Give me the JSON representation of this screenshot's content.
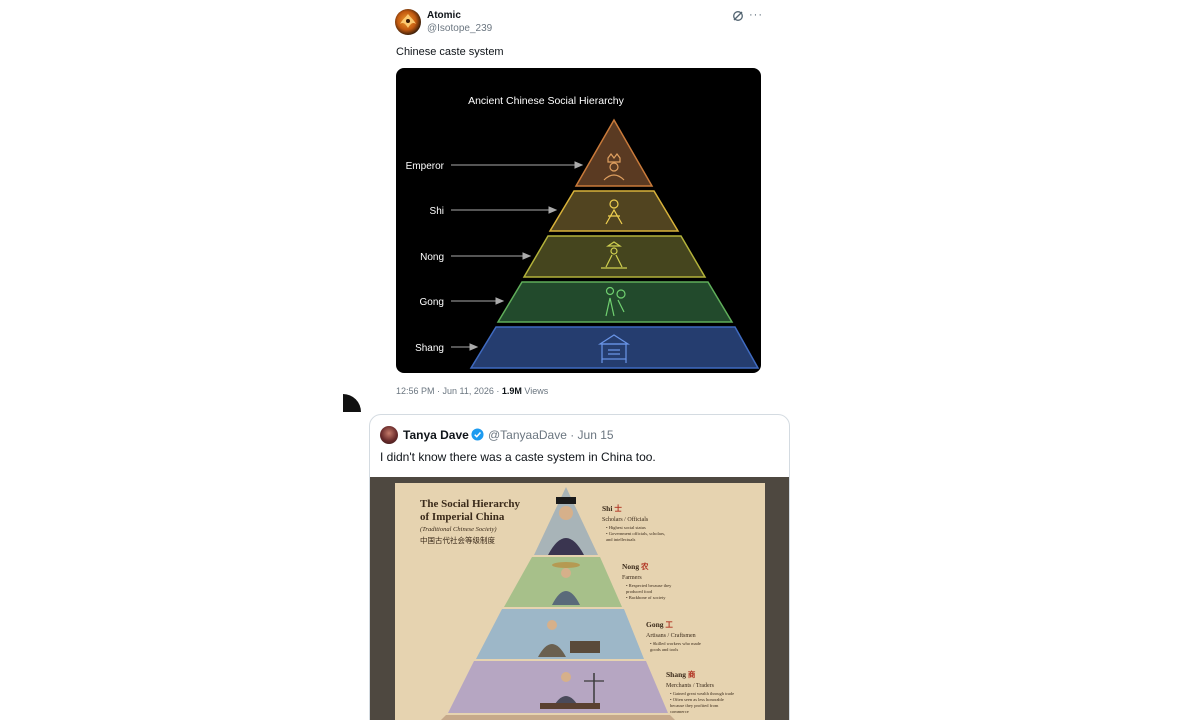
{
  "tweet1": {
    "author_name": "Atomic",
    "author_handle": "@Isotope_239",
    "text": "Chinese caste system",
    "timestamp": "12:56 PM · Jun 11, 2026 · ",
    "views_count": "1.9M",
    "views_label": " Views",
    "icons": [
      "grok-icon",
      "more-icon"
    ],
    "more_glyph": "···",
    "image": {
      "title": "Ancient Chinese Social Hierarchy",
      "levels": [
        {
          "label": "Emperor",
          "color": "#c97a3a"
        },
        {
          "label": "Shi",
          "color": "#d8b23a"
        },
        {
          "label": "Nong",
          "color": "#b3b23a"
        },
        {
          "label": "Gong",
          "color": "#5fae5a"
        },
        {
          "label": "Shang",
          "color": "#3f6ac0"
        }
      ]
    }
  },
  "tweet2": {
    "author_name": "Tanya Dave",
    "author_handle": "@TanyaaDave · Jun 15",
    "text": "I didn't know there was a caste system in China too.",
    "image": {
      "title_line1": "The Social Hierarchy",
      "title_line2": "of Imperial China",
      "subtitle": "(Traditional Chinese Society)",
      "chinese_caption": "中国古代社会等级制度",
      "tiers": [
        {
          "name": "Shi",
          "glyph": "士",
          "role": "Scholars / Officials",
          "notes": [
            "• Highest social status",
            "• Government officials, scholars,",
            "  and intellectuals"
          ]
        },
        {
          "name": "Nong",
          "glyph": "农",
          "role": "Farmers",
          "notes": [
            "• Respected because they",
            "  produced food",
            "• Backbone of society"
          ]
        },
        {
          "name": "Gong",
          "glyph": "工",
          "role": "Artisans / Craftsmen",
          "notes": [
            "• Skilled workers who made",
            "  goods and tools"
          ]
        },
        {
          "name": "Shang",
          "glyph": "商",
          "role": "Merchants / Traders",
          "notes": [
            "• Gained great wealth through trade",
            "• Often seen as less honorable",
            "  because they profited from",
            "  commerce"
          ]
        }
      ]
    }
  }
}
